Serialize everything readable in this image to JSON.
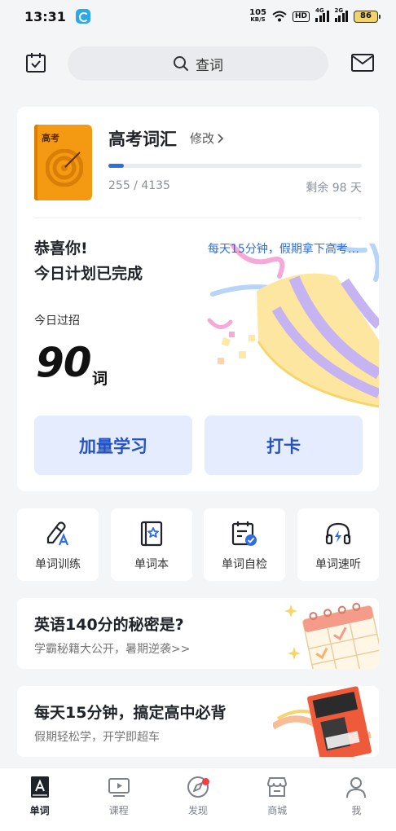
{
  "status_bar": {
    "time": "13:31",
    "net_speed": "105",
    "net_unit": "KB/S",
    "hd_label": "HD",
    "signal1_label": "4G",
    "signal2_label": "2G",
    "battery": "86"
  },
  "top_bar": {
    "search_label": "查词",
    "left_icon": "calendar-check-icon",
    "right_icon": "mail-icon"
  },
  "book": {
    "cover_label": "高考",
    "title": "高考词汇",
    "edit_label": "修改",
    "progress_text": "255 / 4135",
    "progress_fraction": 0.0617,
    "days_left": "剩余 98 天"
  },
  "today": {
    "congrats_line1": "恭喜你!",
    "congrats_line2": "今日计划已完成",
    "promo": "每天15分钟，假期拿下高考词汇",
    "label": "今日过招",
    "count": "90",
    "unit": "词"
  },
  "actions": {
    "study_more": "加量学习",
    "check_in": "打卡"
  },
  "tools": [
    {
      "label": "单词训练",
      "icon": "pencil-a-icon"
    },
    {
      "label": "单词本",
      "icon": "star-book-icon"
    },
    {
      "label": "单词自检",
      "icon": "calendar-check-icon"
    },
    {
      "label": "单词速听",
      "icon": "headphones-bolt-icon"
    }
  ],
  "banners": [
    {
      "title": "英语140分的秘密是?",
      "subtitle": "学霸秘籍大公开，暑期逆袭>>"
    },
    {
      "title": "每天15分钟，搞定高中必背",
      "subtitle": "假期轻松学，开学即超车"
    }
  ],
  "nav": [
    {
      "label": "单词",
      "icon": "word-book-icon",
      "active": true
    },
    {
      "label": "课程",
      "icon": "video-play-icon"
    },
    {
      "label": "发现",
      "icon": "compass-icon",
      "badge": true
    },
    {
      "label": "商城",
      "icon": "store-icon"
    },
    {
      "label": "我",
      "icon": "person-icon"
    }
  ],
  "colors": {
    "accent": "#2e6de4",
    "button_bg": "#e4ecfd",
    "button_text": "#2553c4",
    "book_orange": "#f39a12",
    "badge_red": "#f04040"
  }
}
